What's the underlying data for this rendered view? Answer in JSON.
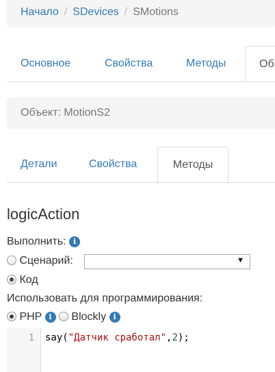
{
  "breadcrumb": {
    "home": "Начало",
    "devices": "SDevices",
    "current": "SMotions"
  },
  "top_tabs": [
    {
      "label": "Основное"
    },
    {
      "label": "Свойства"
    },
    {
      "label": "Методы"
    },
    {
      "label": "Об"
    }
  ],
  "object_label": "Объект: MotionS2",
  "sub_tabs": [
    {
      "label": "Детали"
    },
    {
      "label": "Свойства"
    },
    {
      "label": "Методы"
    }
  ],
  "method": {
    "title": "logicAction",
    "execute_label": "Выполнить:",
    "script_label": "Сценарий:",
    "script_value": "",
    "code_label": "Код",
    "use_label": "Использовать для программирования:",
    "php_label": "PHP",
    "blockly_label": "Blockly",
    "info_glyph": "i",
    "select_arrow": "▼"
  },
  "editor": {
    "line_number": "1",
    "code_prefix": "say(",
    "code_string": "\"Датчик сработал\"",
    "code_mid": ",",
    "code_number": "2",
    "code_suffix": ");"
  }
}
